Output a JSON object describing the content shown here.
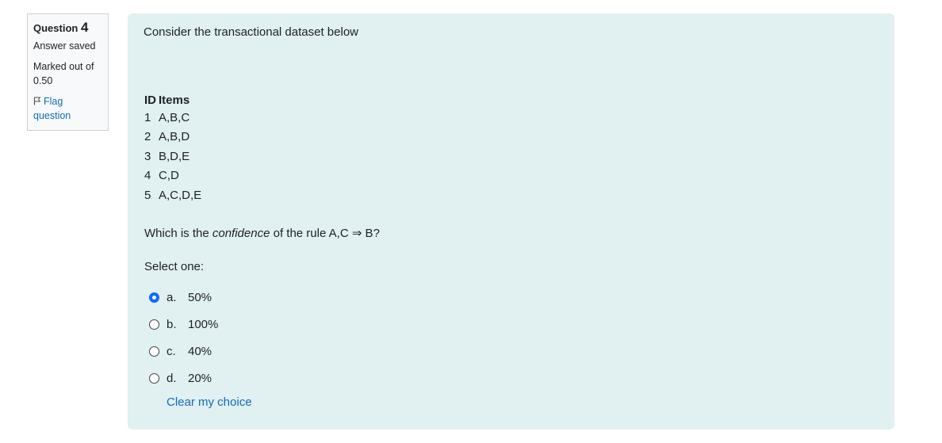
{
  "info": {
    "question_label": "Question",
    "question_number": "4",
    "state": "Answer saved",
    "grade_line1": "Marked out of",
    "grade_line2": "0.50",
    "flag_line1": "Flag",
    "flag_line2": "question"
  },
  "content": {
    "intro": "Consider the transactional dataset below",
    "table": {
      "headers": [
        "ID",
        "Items"
      ],
      "rows": [
        [
          "1",
          "A,B,C"
        ],
        [
          "2",
          "A,B,D"
        ],
        [
          "3",
          "B,D,E"
        ],
        [
          "4",
          "C,D"
        ],
        [
          "5",
          "A,C,D,E"
        ]
      ]
    },
    "question_prefix": "Which is the ",
    "question_emphasis": "confidence",
    "question_suffix": " of the rule A,C ⇒ B?",
    "select_prompt": "Select one:",
    "options": [
      {
        "letter": "a.",
        "text": "50%",
        "selected": true
      },
      {
        "letter": "b.",
        "text": "100%",
        "selected": false
      },
      {
        "letter": "c.",
        "text": "40%",
        "selected": false
      },
      {
        "letter": "d.",
        "text": "20%",
        "selected": false
      }
    ],
    "clear_label": "Clear my choice"
  },
  "colors": {
    "accent": "#0f6cbf",
    "radio_selected": "#0f6cfc",
    "content_bg": "#e1f0f0",
    "info_bg": "#f8f9fa"
  }
}
